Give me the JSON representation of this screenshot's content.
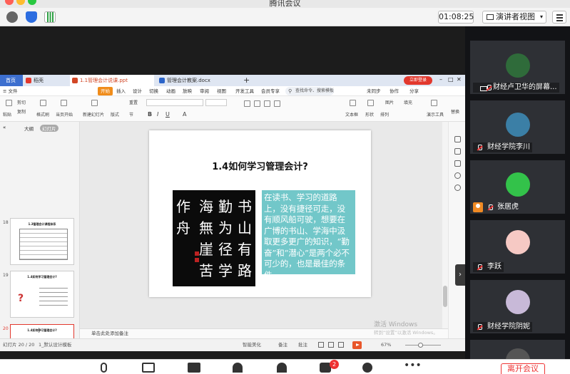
{
  "window": {
    "title": "腾讯会议"
  },
  "meeting_toolbar": {
    "timer": "01:08:25",
    "view_label": "演讲者视图",
    "view_caret": "▾"
  },
  "wps": {
    "tabs": {
      "home": "首页",
      "drk": "稻壳",
      "ppt": "1.1管理会计说课.ppt",
      "doc": "管理会计教案.docx",
      "plus": "+"
    },
    "login_badge": "立即登录",
    "menu": {
      "file": "≡ 文件",
      "start": "开始",
      "insert": "插入",
      "design": "设计",
      "switch": "切换",
      "animation": "动画",
      "show": "放映",
      "review": "审阅",
      "view": "视图",
      "dev": "开发工具",
      "vip": "会员专享",
      "search": "查找命令、搜索模板",
      "sync": "未同步",
      "collab": "协作",
      "share": "分享"
    },
    "tools": {
      "paste": "粘贴",
      "cut": "剪切",
      "copy": "复制",
      "format": "格式刷",
      "from_current": "当页开始",
      "new_slide": "新建幻灯片",
      "layout": "版式",
      "section": "节",
      "reset": "重置",
      "textbox": "文本框",
      "shape": "形状",
      "arrange": "排列",
      "picture": "图片",
      "fill": "填充",
      "play": "演示工具",
      "replace": "替换"
    },
    "pane": {
      "outline": "大纲",
      "slides": "幻灯片",
      "add": "+"
    },
    "thumbnails": [
      {
        "num": "18",
        "title": "1.3管理会计课程体系"
      },
      {
        "num": "19",
        "title": "1.4如何学习管理会计?"
      },
      {
        "num": "20",
        "title": "1.4如何学习管理会计?"
      }
    ],
    "slide": {
      "title": "1.4如何学习管理会计?",
      "calligraphy_cols": [
        "书山有路",
        "勤为径学",
        "海無崖苦",
        "作舟"
      ],
      "quote": "在读书、学习的道路上，没有捷径可走，没有顺风船可驶，想要在广博的书山、学海中汲取更多更广的知识，“勤奋”和“潜心”是两个必不可少的，也是最佳的条件"
    },
    "notes_placeholder": "单击此处添加备注",
    "status": {
      "page": "幻灯片 20 / 20",
      "theme": "1_默认设计模板",
      "smart": "智能美化",
      "notes": "备注",
      "comment": "批注",
      "zoom": "67%"
    },
    "watermark": {
      "line1": "激活 Windows",
      "line2": "转到“设置”以激活 Windows。"
    }
  },
  "participants": [
    {
      "name": "财经卢卫华的屏幕...",
      "avatar_color": "#2f6b3a"
    },
    {
      "name": "财经学院李川",
      "avatar_color": "#3b7fa6"
    },
    {
      "name": "张居虎",
      "avatar_color": "#33c24a"
    },
    {
      "name": "李跃",
      "avatar_color": "#f6c9c4"
    },
    {
      "name": "财经学院阴妮",
      "avatar_color": "#c8b9d8"
    }
  ],
  "bottom": {
    "chat_count": "2",
    "end_label": "离开会议"
  },
  "colors": {
    "accent": "#e2382d",
    "wps_blue": "#3d6fcf",
    "quote_bg": "#72c7c9"
  }
}
